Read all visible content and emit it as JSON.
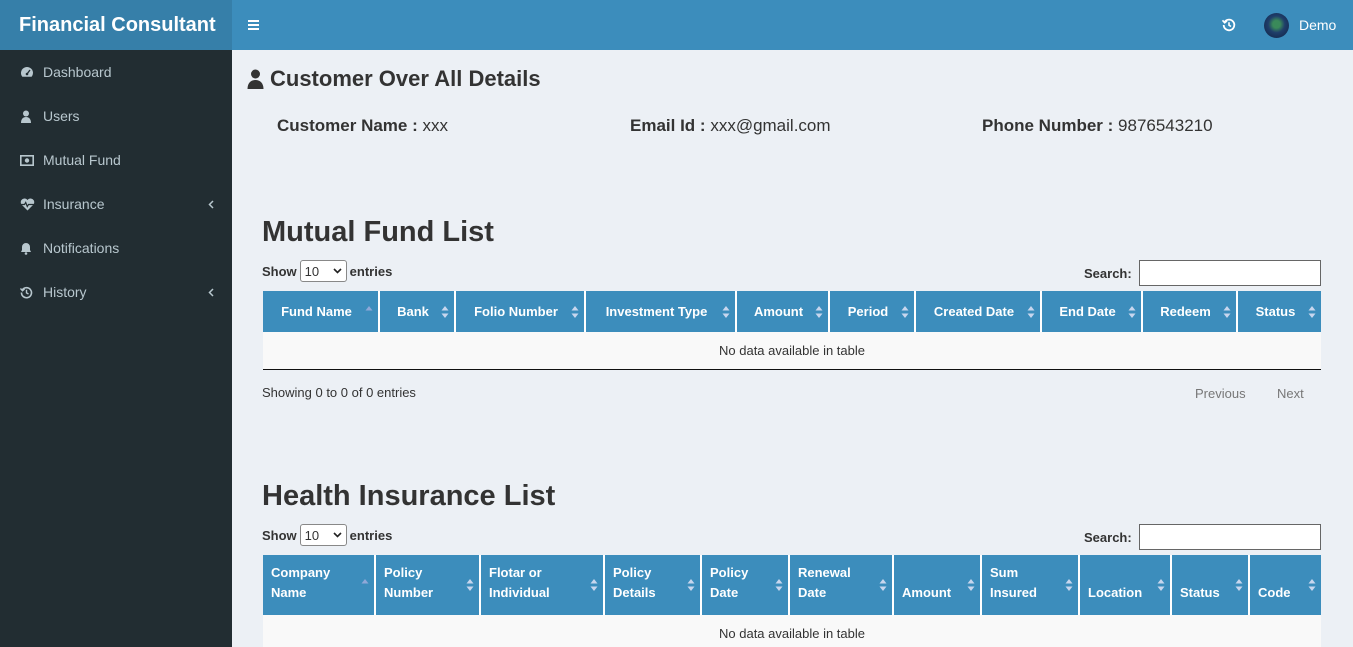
{
  "app": {
    "title": "Financial Consultant"
  },
  "sidebar": {
    "items": [
      {
        "label": "Dashboard",
        "icon": "dashboard-icon",
        "chevron": false
      },
      {
        "label": "Users",
        "icon": "user-icon",
        "chevron": false
      },
      {
        "label": "Mutual Fund",
        "icon": "money-icon",
        "chevron": false
      },
      {
        "label": "Insurance",
        "icon": "heartbeat-icon",
        "chevron": true
      },
      {
        "label": "Notifications",
        "icon": "bell-icon",
        "chevron": false
      },
      {
        "label": "History",
        "icon": "history-icon",
        "chevron": true
      }
    ]
  },
  "header": {
    "user_name": "Demo"
  },
  "page": {
    "title": "Customer Over All Details",
    "customer_name_label": "Customer Name :",
    "customer_name": "xxx",
    "email_label": "Email Id :",
    "email": "xxx@gmail.com",
    "phone_label": "Phone Number :",
    "phone": "9876543210"
  },
  "mutual_fund": {
    "title": "Mutual Fund List",
    "show_label": "Show",
    "entries_label": "entries",
    "page_size": "10",
    "search_label": "Search:",
    "columns": [
      "Fund Name",
      "Bank",
      "Folio Number",
      "Investment Type",
      "Amount",
      "Period",
      "Created Date",
      "End Date",
      "Redeem",
      "Status"
    ],
    "empty_text": "No data available in table",
    "info_text": "Showing 0 to 0 of 0 entries",
    "previous_label": "Previous",
    "next_label": "Next"
  },
  "health_insurance": {
    "title": "Health Insurance List",
    "show_label": "Show",
    "entries_label": "entries",
    "page_size": "10",
    "search_label": "Search:",
    "columns": [
      [
        "Company",
        "Name"
      ],
      [
        "Policy",
        "Number"
      ],
      [
        "Flotar or",
        "Individual"
      ],
      [
        "Policy",
        "Details"
      ],
      [
        "Policy",
        "Date"
      ],
      [
        "Renewal",
        "Date"
      ],
      [
        "",
        "Amount"
      ],
      [
        "Sum",
        "Insured"
      ],
      [
        "",
        "Location"
      ],
      [
        "",
        "Status"
      ],
      [
        "",
        "Code"
      ]
    ],
    "empty_text": "No data available in table"
  },
  "colors": {
    "brand_bar": "#367fa9",
    "header": "#3c8dbc",
    "sidebar_bg": "#222d32",
    "sidebar_text": "#b8c7ce",
    "content_bg": "#ecf0f5",
    "table_header": "#3c8dbc"
  }
}
